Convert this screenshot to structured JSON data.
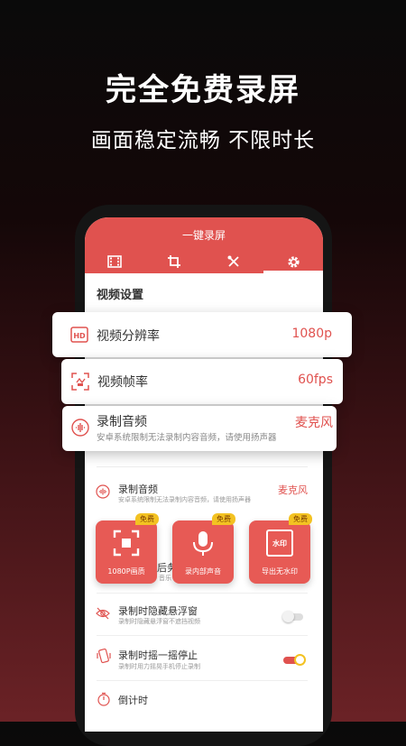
{
  "promo": {
    "headline": "完全免费录屏",
    "subline": "画面稳定流畅 不限时长"
  },
  "app": {
    "title": "一键录屏",
    "tabs": [
      {
        "icon": "film-icon",
        "active": false
      },
      {
        "icon": "crop-icon",
        "active": false
      },
      {
        "icon": "tools-icon",
        "active": false
      },
      {
        "icon": "gear-icon",
        "active": true
      }
    ],
    "section_title": "视频设置"
  },
  "cards": {
    "resolution": {
      "label": "视频分辨率",
      "value": "1080p"
    },
    "framerate": {
      "label": "视频帧率",
      "value": "60fps"
    },
    "audio": {
      "label": "录制音频",
      "value": "麦克风",
      "sub": "安卓系统限制无法录制内容音频，请使用扬声器"
    }
  },
  "list": {
    "audio": {
      "title": "录制音频",
      "sub": "安卓系统限制无法录制内容音频，请使用扬声器",
      "value": "麦克风"
    },
    "partial": {
      "title_fragment": "后务",
      "sub_fragment": "音乐"
    },
    "hide_float": {
      "title": "录制时隐藏悬浮窗",
      "sub": "录制时隐藏悬浮窗不遮挡视频",
      "enabled": false
    },
    "shake_stop": {
      "title": "录制时摇一摇停止",
      "sub": "录制时用力摇晃手机停止录制",
      "enabled": true
    },
    "countdown": {
      "title": "倒计时"
    }
  },
  "features": [
    {
      "label": "1080P画质",
      "badge": "免费",
      "icon": "fullscreen-icon"
    },
    {
      "label": "录内部声音",
      "badge": "免费",
      "icon": "microphone-icon"
    },
    {
      "label": "导出无水印",
      "badge": "免费",
      "icon": "no-watermark-icon",
      "icon_text": "水印"
    }
  ],
  "colors": {
    "accent": "#e0524f",
    "badge": "#f3c222",
    "toggle_on": "#f3c222"
  }
}
